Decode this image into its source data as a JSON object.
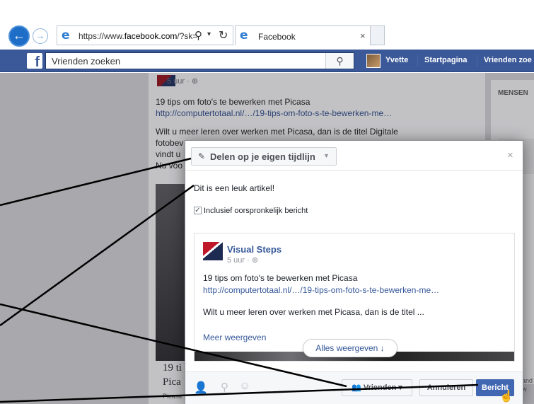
{
  "browser": {
    "url_prefix": "https://www.",
    "url_domain": "facebook.com",
    "url_suffix": "/?sk=",
    "tab_title": "Facebook",
    "tab_close": "×",
    "back_icon": "arrow-left-icon",
    "forward_icon": "arrow-right-icon"
  },
  "facebook_bar": {
    "logo": "f",
    "search_value": "Vrienden zoeken",
    "user_name": "Yvette",
    "home_label": "Startpagina",
    "friends_label": "Vrienden zoe"
  },
  "feed": {
    "time": "5 uur · ⊕",
    "post_title": "19 tips om foto's te bewerken met Picasa",
    "post_url": "http://computertotaal.nl/…/19-tips-om-foto-s-te-bewerken-me…",
    "post_text_line1": "Wilt u meer leren over werken met Picasa, dan is de titel Digitale",
    "post_text_line2": "fotobev",
    "post_text_line3": "vindt u",
    "post_text_line4": "Nu voo",
    "bottom_title_line1": "19 ti",
    "bottom_title_line2": "Pica",
    "bottom_source": "Picasa"
  },
  "right_column": {
    "label": "MENSEN",
    "snippet": "and\nw"
  },
  "share_dialog": {
    "share_target_label": "Delen op je eigen tijdlijn",
    "close_label": "×",
    "compose_text": "Dit is een leuk artikel!",
    "include_original_label": "Inclusief oorspronkelijk bericht",
    "include_original_checked": true,
    "attachment": {
      "page_name": "Visual Steps",
      "time": "5 uur · ⊕",
      "title": "19 tips om foto's te bewerken met Picasa",
      "url": "http://computertotaal.nl/…/19-tips-om-foto-s-te-bewerken-me…",
      "description": "Wilt u meer leren over werken met Picasa, dan is de titel ...",
      "more_label": "Meer weergeven"
    },
    "show_all_label": "Alles weergeven ↓",
    "audience_label": "Vrienden",
    "cancel_label": "Annuleren",
    "post_label": "Bericht"
  },
  "colors": {
    "facebook_blue": "#3b5998",
    "post_button": "#4267b2",
    "link": "#365899"
  }
}
